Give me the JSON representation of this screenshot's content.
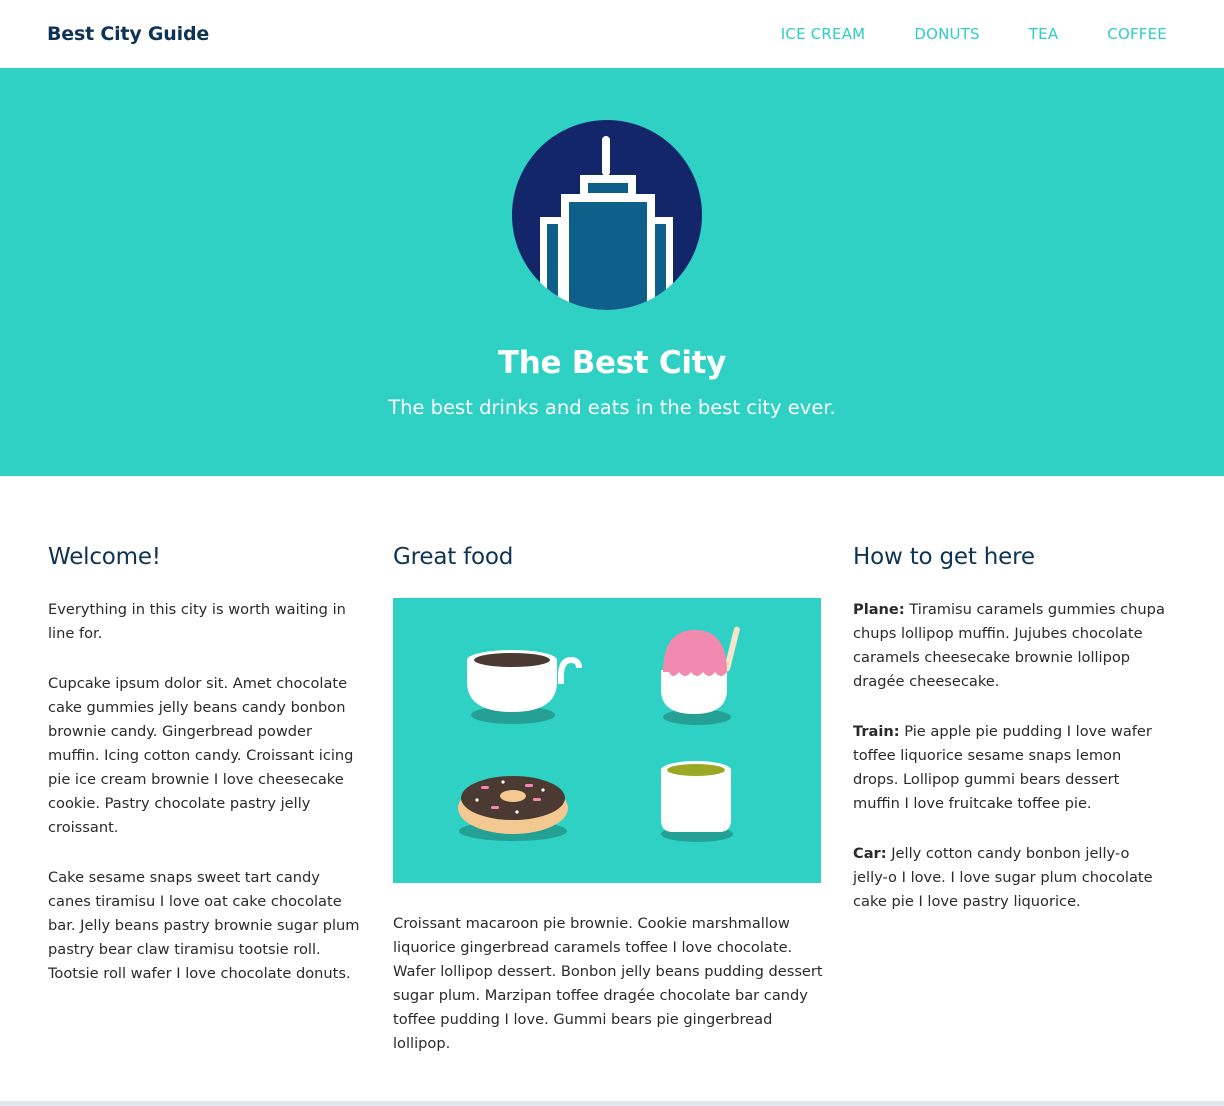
{
  "navbar": {
    "brand": "Best City Guide",
    "links": [
      "ICE CREAM",
      "DONUTS",
      "TEA",
      "COFFEE"
    ]
  },
  "hero": {
    "title": "The Best City",
    "subtitle": "The best drinks and eats in the best city ever."
  },
  "welcome": {
    "heading": "Welcome!",
    "paragraphs": [
      "Everything in this city is worth waiting in line for.",
      "Cupcake ipsum dolor sit. Amet chocolate cake gummies jelly beans candy bonbon brownie candy. Gingerbread powder muffin. Icing cotton candy. Croissant icing pie ice cream brownie I love cheesecake cookie. Pastry chocolate pastry jelly croissant.",
      "Cake sesame snaps sweet tart candy canes tiramisu I love oat cake chocolate bar. Jelly beans pastry brownie sugar plum pastry bear claw tiramisu tootsie roll. Tootsie roll wafer I love chocolate donuts."
    ]
  },
  "food": {
    "heading": "Great food",
    "paragraph": "Croissant macaroon pie brownie. Cookie marshmallow liquorice gingerbread caramels toffee I love chocolate. Wafer lollipop dessert. Bonbon jelly beans pudding dessert sugar plum. Marzipan toffee dragée chocolate bar candy toffee pudding I love. Gummi bears pie gingerbread lollipop."
  },
  "travel": {
    "heading": "How to get here",
    "items": [
      {
        "label": "Plane:",
        "text": " Tiramisu caramels gummies chupa chups lollipop muffin. Jujubes chocolate caramels cheesecake brownie lollipop dragée cheesecake."
      },
      {
        "label": "Train:",
        "text": " Pie apple pie pudding I love wafer toffee liquorice sesame snaps lemon drops. Lollipop gummi bears dessert muffin I love fruitcake toffee pie."
      },
      {
        "label": "Car:",
        "text": " Jelly cotton candy bonbon jelly-o jelly-o I love. I love sugar plum chocolate cake pie I love pastry liquorice."
      }
    ]
  },
  "colors": {
    "teal": "#2ed1c4",
    "navy": "#0e3354",
    "emblem_circle": "#13266a",
    "tower_fill": "#0e5f8a"
  },
  "icons": [
    "city-tower-icon",
    "coffee-cup-icon",
    "ice-cream-cup-icon",
    "donut-icon",
    "tea-cup-icon"
  ]
}
